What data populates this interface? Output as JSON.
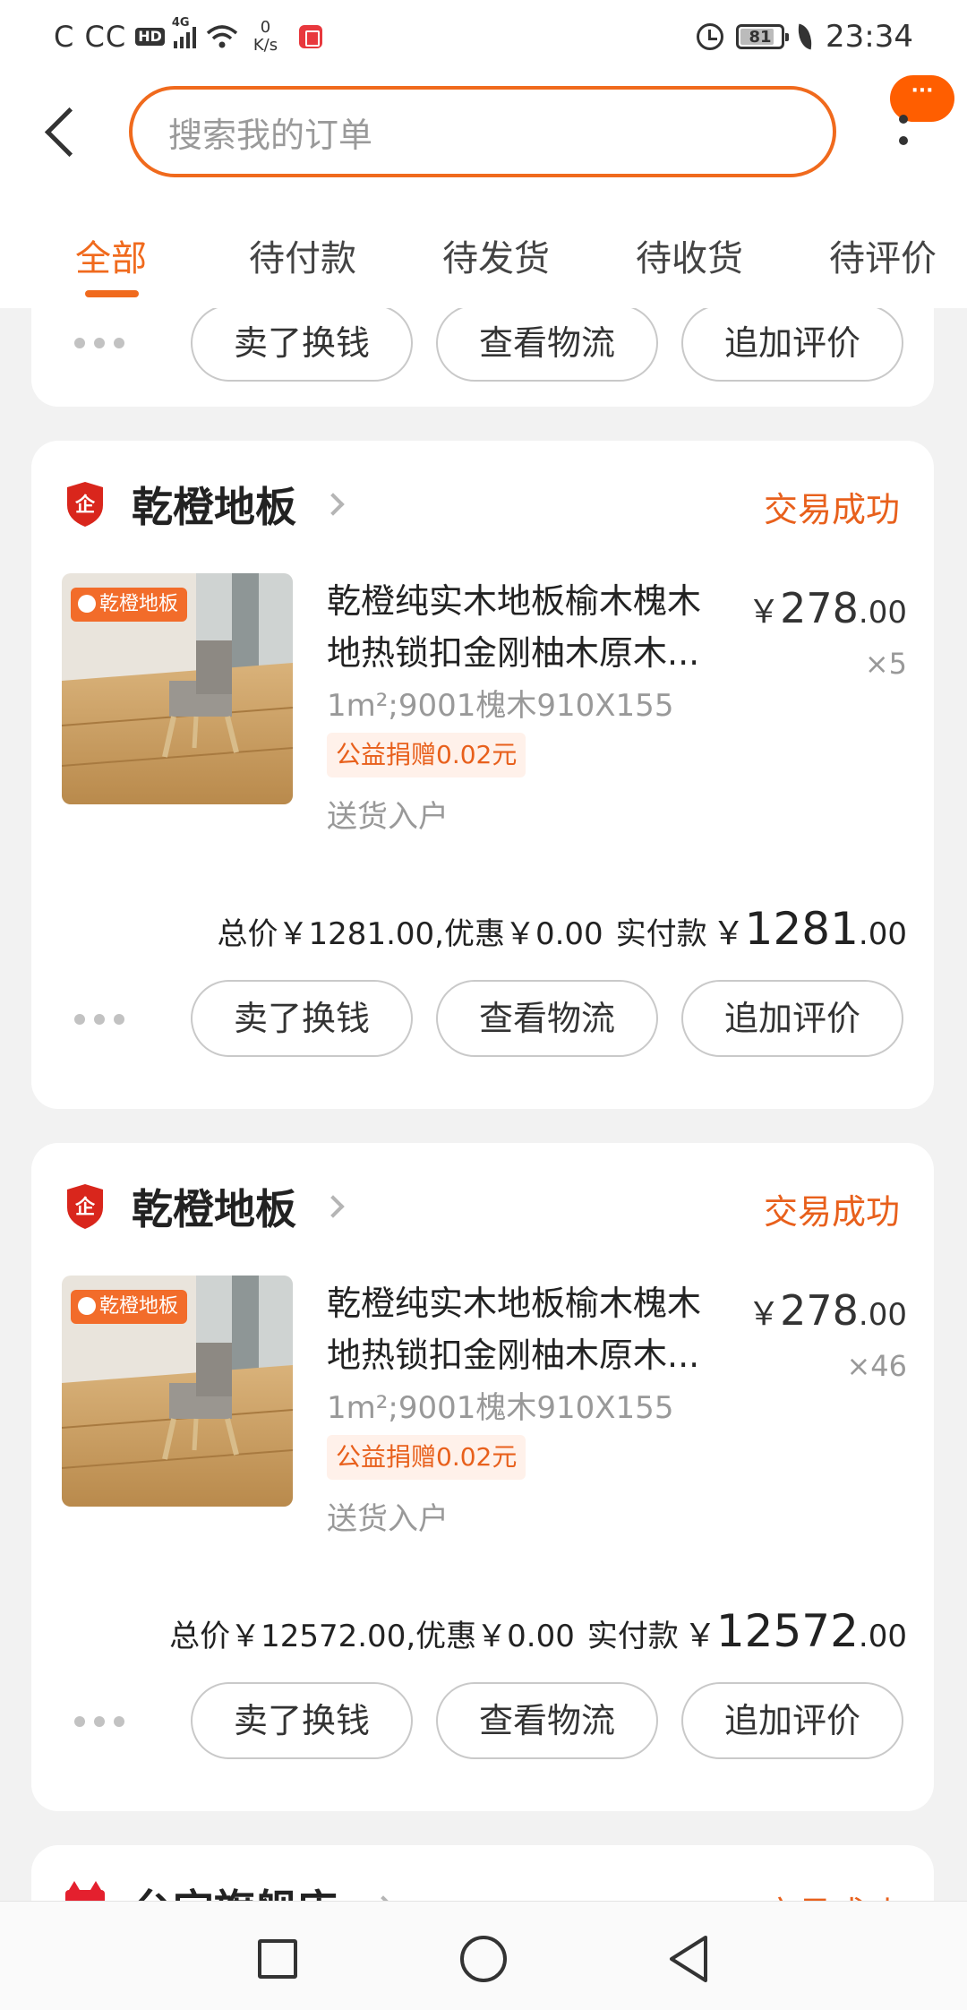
{
  "status_bar": {
    "carrier": "C CC",
    "hd": "HD",
    "network": "4G",
    "net_speed_value": "0",
    "net_speed_unit": "K/s",
    "battery_level": "81",
    "time": "23:34"
  },
  "header": {
    "search_placeholder": "搜索我的订单",
    "menu_badge": "···"
  },
  "tabs": [
    {
      "label": "全部",
      "active": true
    },
    {
      "label": "待付款",
      "active": false
    },
    {
      "label": "待发货",
      "active": false
    },
    {
      "label": "待收货",
      "active": false
    },
    {
      "label": "待评价",
      "active": false
    }
  ],
  "actions": {
    "sell": "卖了换钱",
    "logistics": "查看物流",
    "review": "追加评价"
  },
  "orders": [
    {
      "shop_name": "乾橙地板",
      "status": "交易成功",
      "thumb_label": "乾橙地板",
      "title_line1": "乾橙纯实木地板榆木槐木",
      "title_line2": "地热锁扣金刚柚木原木...",
      "price_int": "278",
      "price_dec": ".00",
      "quantity": "×5",
      "sku": "1m²;9001槐木910X155",
      "donation": "公益捐赠0.02元",
      "delivery": "送货入户",
      "summary": "总价￥1281.00,优惠￥0.00",
      "paid_label": "实付款",
      "paid_int": "1281",
      "paid_dec": ".00"
    },
    {
      "shop_name": "乾橙地板",
      "status": "交易成功",
      "thumb_label": "乾橙地板",
      "title_line1": "乾橙纯实木地板榆木槐木",
      "title_line2": "地热锁扣金刚柚木原木...",
      "price_int": "278",
      "price_dec": ".00",
      "quantity": "×46",
      "sku": "1m²;9001槐木910X155",
      "donation": "公益捐赠0.02元",
      "delivery": "送货入户",
      "summary": "总价￥12572.00,优惠￥0.00",
      "paid_label": "实付款",
      "paid_int": "12572",
      "paid_dec": ".00"
    }
  ],
  "partial_order": {
    "shop_name": "台宝旗舰店",
    "status": "交易成功",
    "badge": "天猫"
  },
  "colors": {
    "accent": "#f06a1d",
    "status_text": "#e8601c",
    "shop_badge": "#d9261c",
    "tmall_red": "#e4202e"
  },
  "icons": [
    "back-arrow-icon",
    "more-menu-icon",
    "enterprise-shield-icon",
    "chevron-right-icon",
    "more-dots-icon",
    "nav-square-icon",
    "nav-circle-icon",
    "nav-triangle-icon"
  ]
}
